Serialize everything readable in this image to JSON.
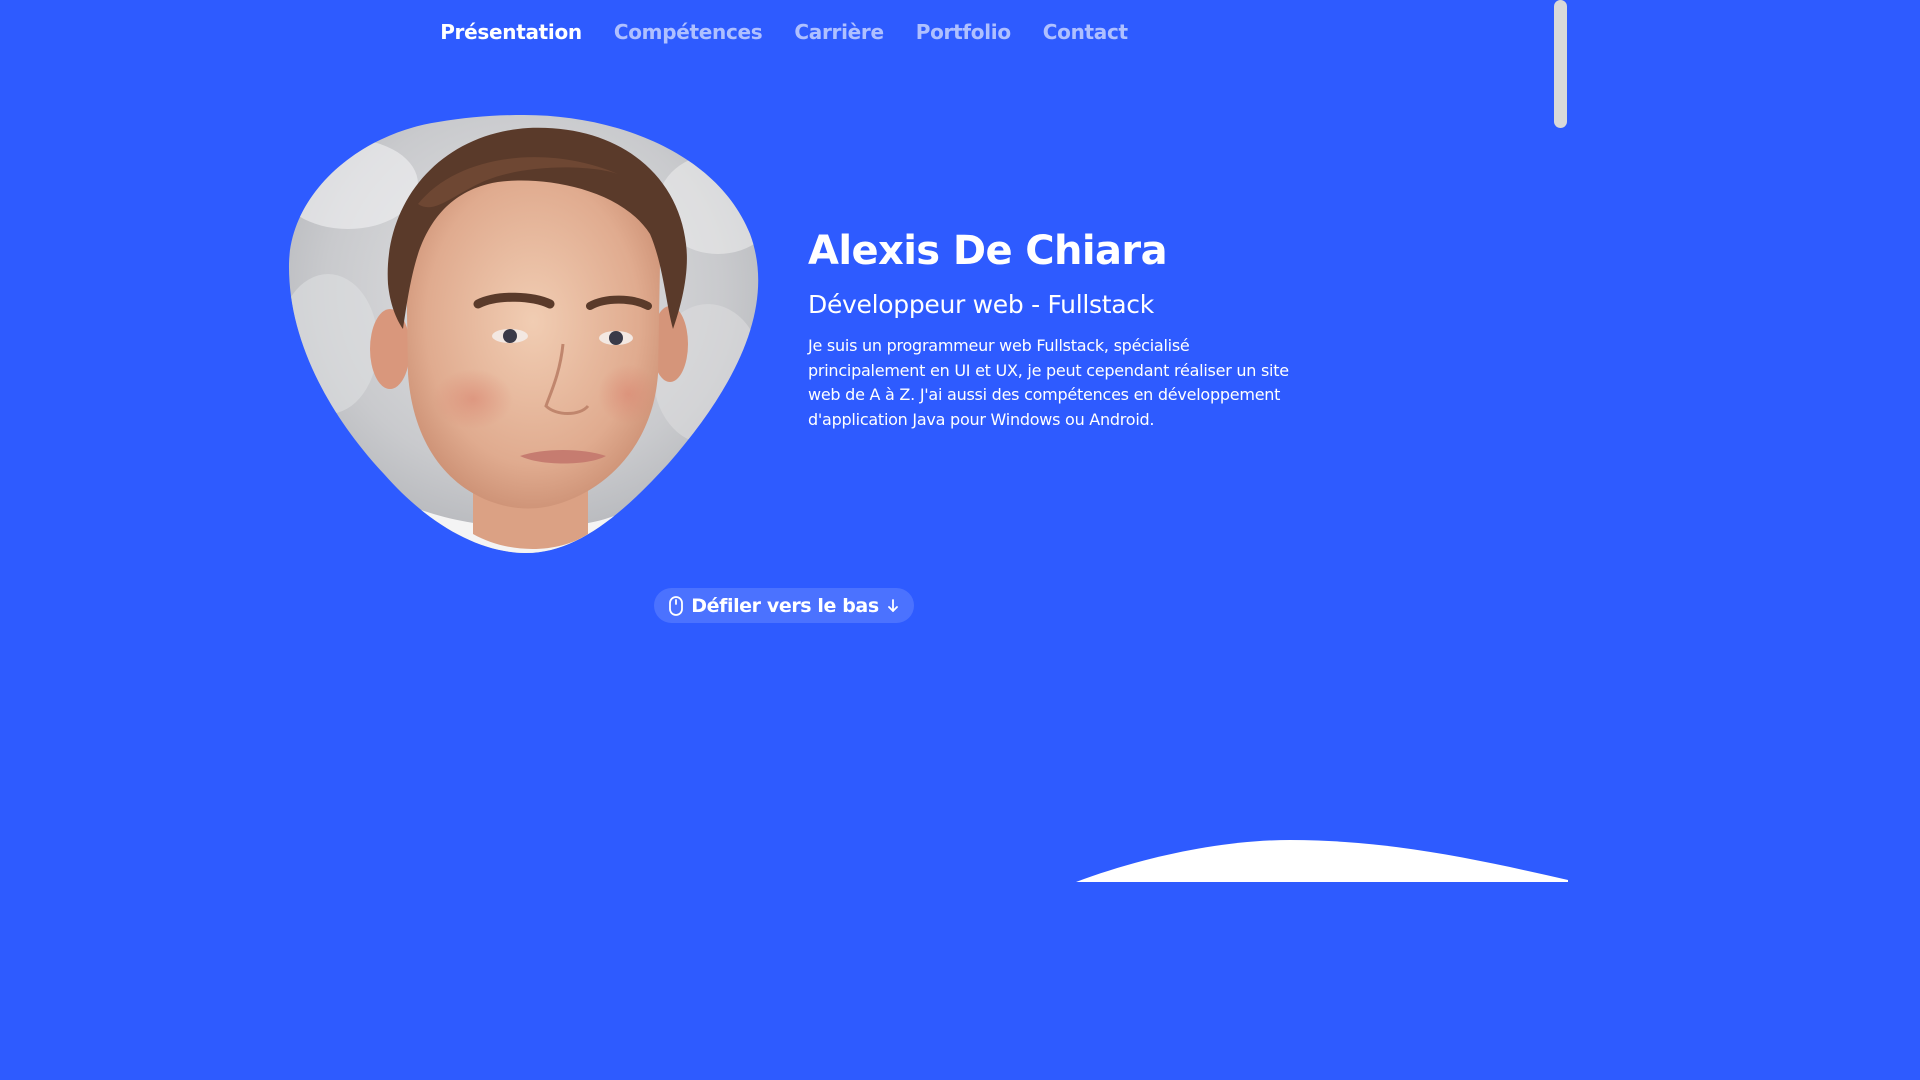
{
  "nav": {
    "items": [
      {
        "label": "Présentation",
        "active": true
      },
      {
        "label": "Compétences",
        "active": false
      },
      {
        "label": "Carrière",
        "active": false
      },
      {
        "label": "Portfolio",
        "active": false
      },
      {
        "label": "Contact",
        "active": false
      }
    ]
  },
  "hero": {
    "name": "Alexis De Chiara",
    "role": "Développeur web - Fullstack",
    "description": "Je suis un programmeur web Fullstack, spécialisé principalement en UI et UX, je peut cependant réaliser un site web de A à Z. J'ai aussi des compétences en développement d'application Java pour Windows ou Android.",
    "photo_icon": "profile-photo"
  },
  "scroll_button": {
    "label": "Défiler vers le bas",
    "icon_left": "mouse-icon",
    "icon_right": "arrow-down-icon"
  },
  "colors": {
    "background": "#2e5bff",
    "text": "#ffffff",
    "nav_inactive": "rgba(255,255,255,0.62)",
    "wave": "#ffffff"
  }
}
